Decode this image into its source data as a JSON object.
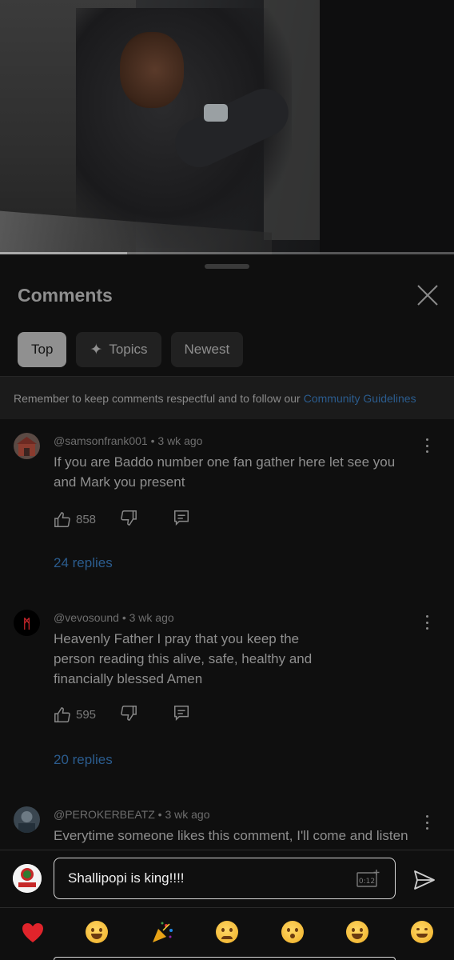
{
  "video": {
    "progress_fraction": 0.28
  },
  "sheet": {
    "title": "Comments",
    "chips": [
      {
        "label": "Top",
        "active": true
      },
      {
        "label": "Topics",
        "active": false
      },
      {
        "label": "Newest",
        "active": false
      }
    ],
    "notice": {
      "text": "Remember to keep comments respectful and to follow our",
      "link": "Community Guidelines"
    }
  },
  "comments": [
    {
      "author": "@samsonfrank001",
      "age": " • 3 wk ago",
      "text": "If you are Baddo number one fan gather here let see you and Mark you present",
      "likes": "858",
      "replies": "24 replies"
    },
    {
      "author": "@vevosound",
      "age": " • 3 wk ago",
      "text": "Heavenly Father I pray that you keep the person reading this alive, safe, healthy and financially blessed Amen",
      "likes": "595",
      "replies": "20 replies"
    },
    {
      "author": "@PEROKERBEATZ",
      "age": " • 3 wk ago",
      "text": "Everytime someone likes this comment, I'll come and listen"
    }
  ],
  "composer": {
    "value": "Shallipopi is king!!!!",
    "timestamp_label": "0:12"
  },
  "emoji_bar": {
    "items": [
      "heart",
      "tears-of-joy",
      "party-popper",
      "crying",
      "surprised",
      "sweat-smile",
      "smiling"
    ]
  }
}
